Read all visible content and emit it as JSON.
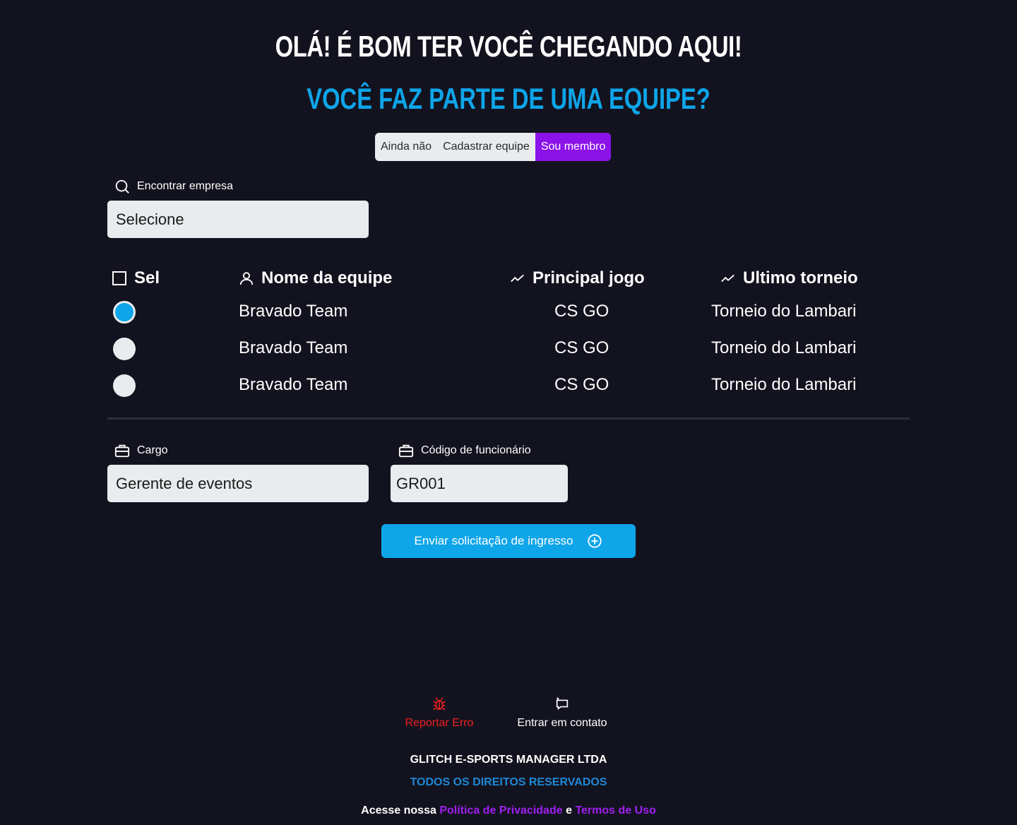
{
  "header": {
    "title": "OLÁ! É BOM TER VOCÊ CHEGANDO AQUI!",
    "subtitle": "VOCÊ FAZ PARTE DE UMA EQUIPE?"
  },
  "team_choice": {
    "options": [
      "Ainda não",
      "Cadastrar equipe",
      "Sou membro"
    ],
    "selected": "Sou membro"
  },
  "company_search": {
    "label": "Encontrar empresa",
    "value": "Selecione",
    "icon": "search-icon"
  },
  "table": {
    "headers": {
      "select": "Sel",
      "team_name": "Nome da equipe",
      "main_game": "Principal jogo",
      "last_tournament": "Ultimo torneio"
    },
    "rows": [
      {
        "selected": true,
        "team_name": "Bravado Team",
        "main_game": "CS GO",
        "last_tournament": "Torneio do Lambari"
      },
      {
        "selected": false,
        "team_name": "Bravado Team",
        "main_game": "CS GO",
        "last_tournament": "Torneio do Lambari"
      },
      {
        "selected": false,
        "team_name": "Bravado Team",
        "main_game": "CS GO",
        "last_tournament": "Torneio do Lambari"
      }
    ]
  },
  "role_field": {
    "label": "Cargo",
    "value": "Gerente de eventos",
    "icon": "briefcase-icon"
  },
  "employee_code_field": {
    "label": "Código de funcionário",
    "value": "GR001",
    "icon": "briefcase-icon"
  },
  "submit": {
    "label": "Enviar solicitação de ingresso",
    "icon": "plus-circle-icon"
  },
  "footer": {
    "report_error": "Reportar Erro",
    "contact": "Entrar em contato",
    "company": "GLITCH E-SPORTS MANAGER LTDA",
    "rights": "TODOS OS DIREITOS RESERVADOS",
    "policy_prefix": "Acesse nossa",
    "privacy_policy": "Política de Privacidade",
    "policy_and": "e",
    "terms": "Termos de Uso"
  },
  "colors": {
    "background": "#13131f",
    "accent_blue": "#0ea5e9",
    "accent_purple": "#8b12e8",
    "error_red": "#f02020",
    "input_bg": "#e9ecee"
  }
}
